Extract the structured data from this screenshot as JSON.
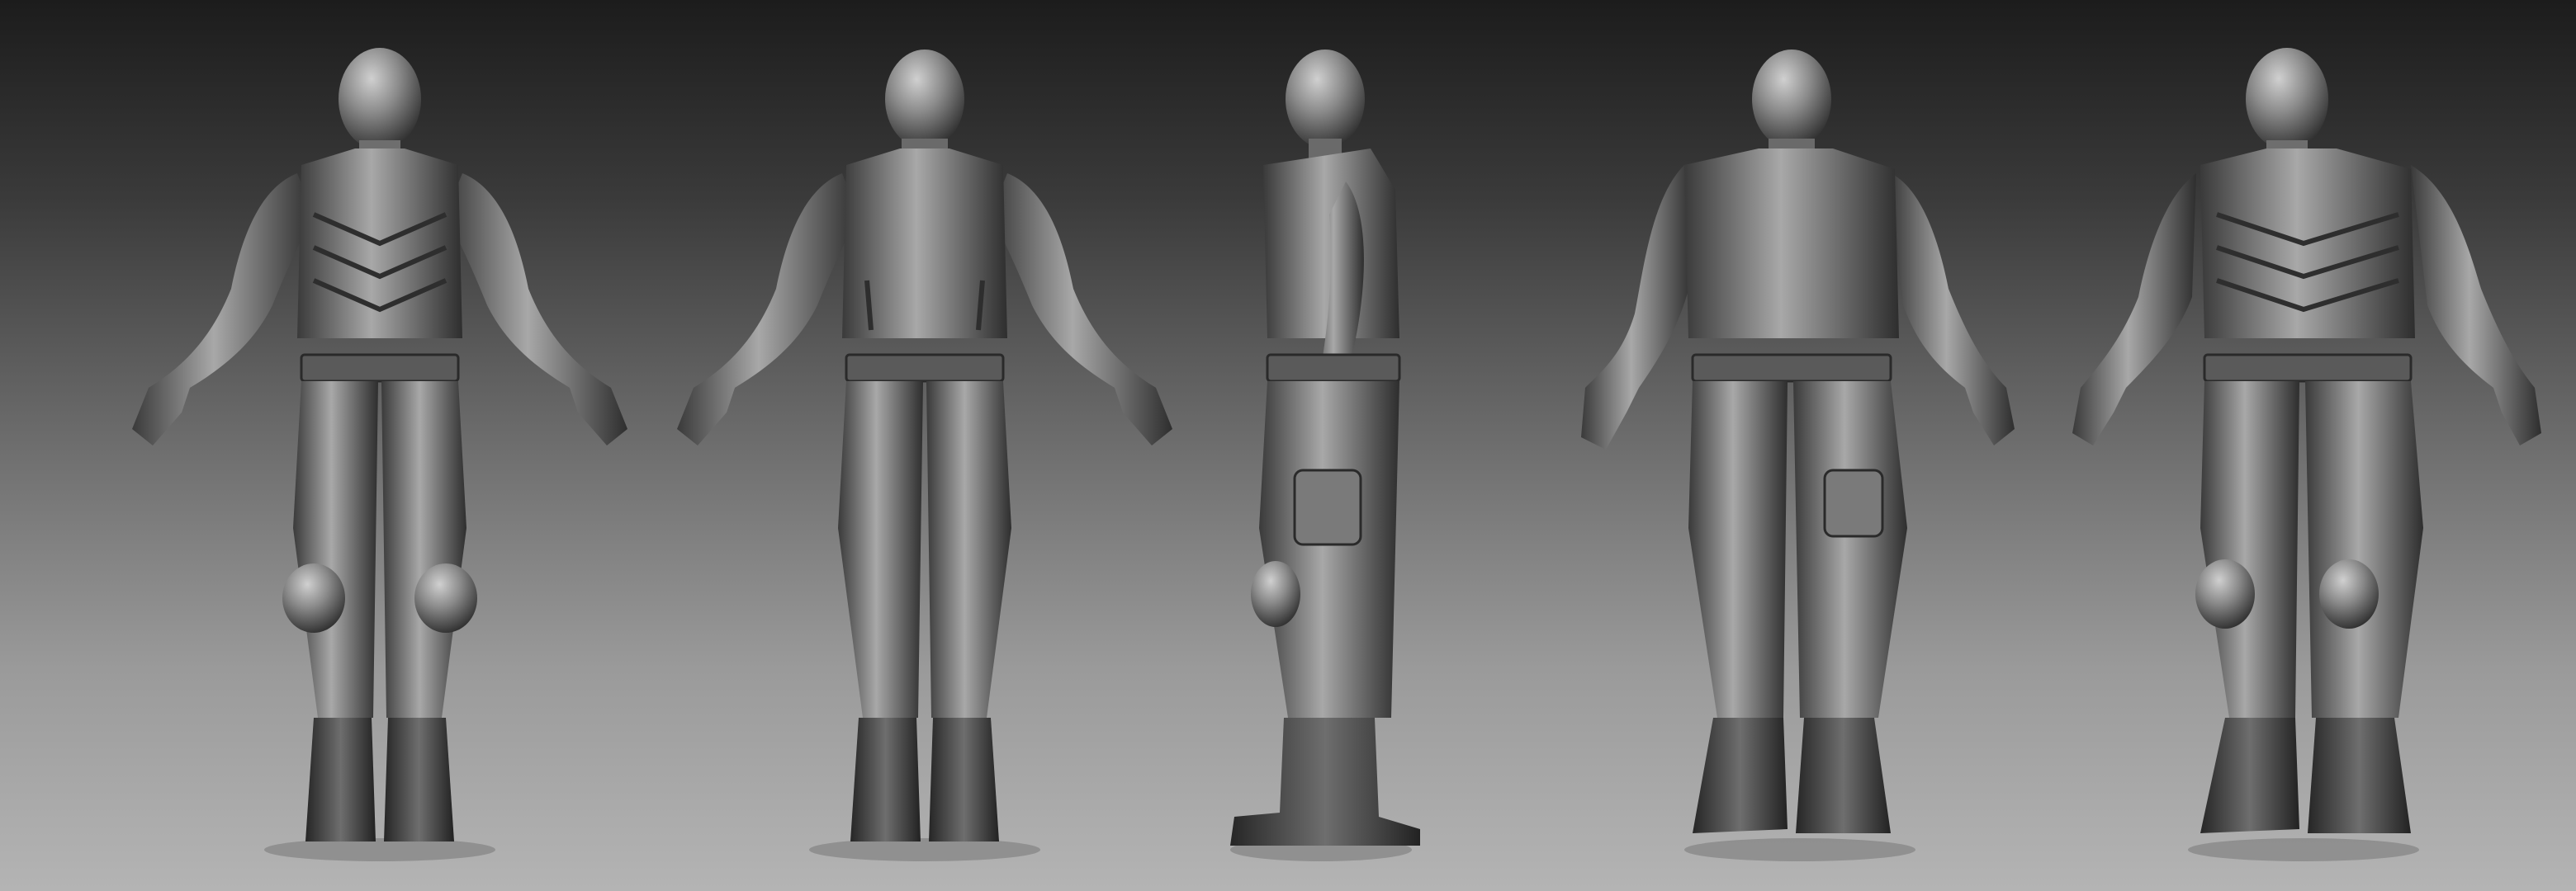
{
  "scene": {
    "background": {
      "top": "#1c1c1c",
      "mid": "#6a6a6a",
      "bottom": "#b4b4b4"
    },
    "material": {
      "base": "#8a8a8a",
      "light": "#d0d0d0",
      "shadow": "#1a1a1a"
    },
    "views": [
      {
        "view": "front"
      },
      {
        "view": "back"
      },
      {
        "view": "side-right"
      },
      {
        "view": "back-three-quarter"
      },
      {
        "view": "front-three-quarter"
      }
    ]
  }
}
